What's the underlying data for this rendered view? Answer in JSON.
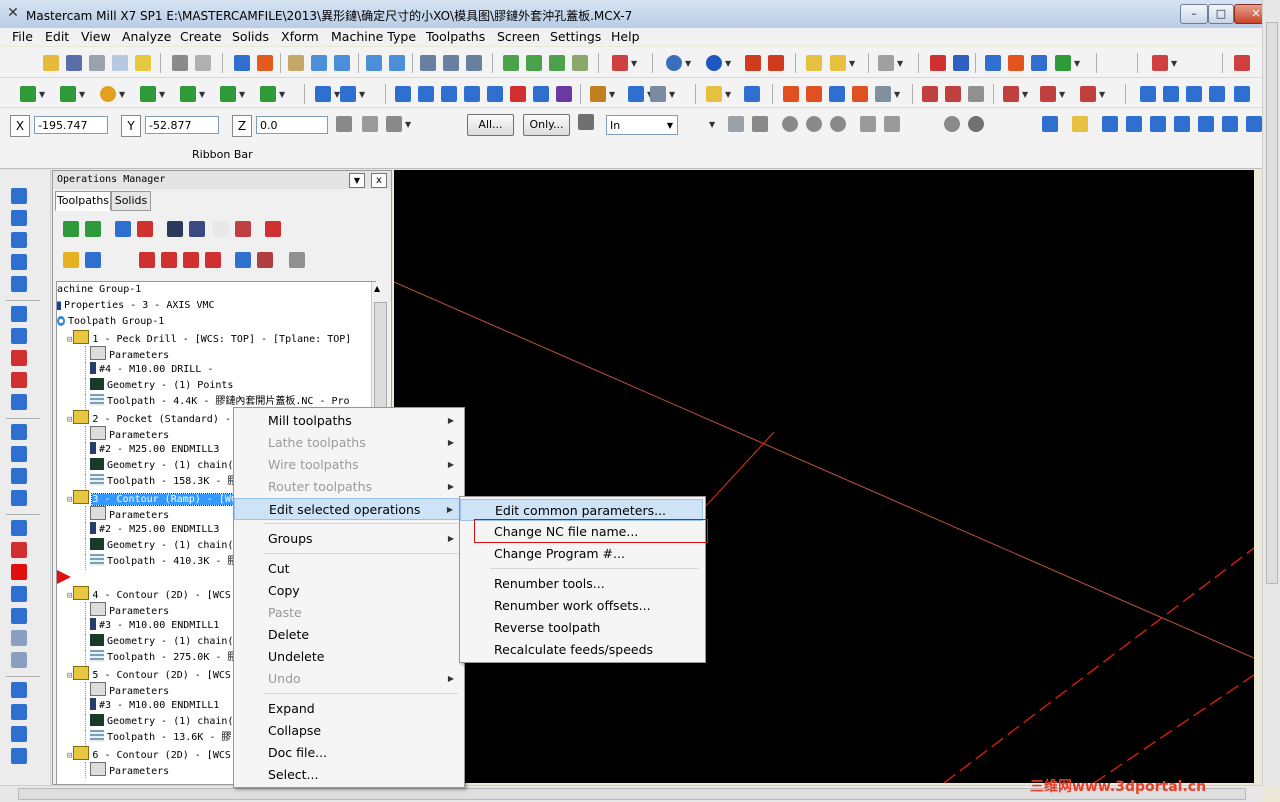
{
  "window": {
    "title": "Mastercam Mill X7 SP1  E:\\MASTERCAMFILE\\2013\\異形鏈\\确定尺寸的小XO\\模具图\\膠鏈外套沖孔蓋板.MCX-7",
    "controls": {
      "minimize": "–",
      "maximize": "□",
      "close": "✕"
    }
  },
  "menubar": [
    "File",
    "Edit",
    "View",
    "Analyze",
    "Create",
    "Solids",
    "Xform",
    "Machine Type",
    "Toolpaths",
    "Screen",
    "Settings",
    "Help"
  ],
  "ribbon": {
    "x_label": "X",
    "x_value": "-195.747",
    "y_label": "Y",
    "y_value": "-52.877",
    "z_label": "Z",
    "z_value": "0.0",
    "all_button": "All...",
    "only_button": "Only...",
    "unit_select": "In",
    "ribbon_bar_label": "Ribbon Bar"
  },
  "ops_manager": {
    "header": "Operations Manager",
    "tabs": [
      "Toolpaths",
      "Solids"
    ],
    "tree": [
      {
        "text": "achine Group-1",
        "indent": 0,
        "icon": "none"
      },
      {
        "text": "Properties - 3 - AXIS VMC",
        "indent": 0,
        "icon": "properties-icon"
      },
      {
        "text": "Toolpath Group-1",
        "indent": 0,
        "icon": "group-icon"
      },
      {
        "text": "1 - Peck Drill - [WCS: TOP] - [Tplane: TOP]",
        "indent": 1,
        "icon": "folder-icon"
      },
      {
        "text": "Parameters",
        "indent": 2,
        "icon": "params-icon"
      },
      {
        "text": "#4 - M10.00 DRILL -",
        "indent": 2,
        "icon": "tool-icon"
      },
      {
        "text": "Geometry - (1) Points",
        "indent": 2,
        "icon": "geometry-icon"
      },
      {
        "text": "Toolpath - 4.4K - 膠鏈內套開片蓋板.NC - Pro",
        "indent": 2,
        "icon": "toolpath-icon"
      },
      {
        "text": "2 - Pocket (Standard) - [",
        "indent": 1,
        "icon": "folder-icon"
      },
      {
        "text": "Parameters",
        "indent": 2,
        "icon": "params-icon"
      },
      {
        "text": "#2 - M25.00 ENDMILL3",
        "indent": 2,
        "icon": "tool-icon"
      },
      {
        "text": "Geometry - (1) chain(",
        "indent": 2,
        "icon": "geometry-icon"
      },
      {
        "text": "Toolpath - 158.3K - 膠",
        "indent": 2,
        "icon": "toolpath-icon"
      },
      {
        "text": "3 - Contour (Ramp) - [WC",
        "indent": 1,
        "icon": "folder-icon",
        "selected": true
      },
      {
        "text": "Parameters",
        "indent": 2,
        "icon": "params-icon"
      },
      {
        "text": "#2 - M25.00 ENDMILL3",
        "indent": 2,
        "icon": "tool-icon"
      },
      {
        "text": "Geometry - (1) chain(",
        "indent": 2,
        "icon": "geometry-icon"
      },
      {
        "text": "Toolpath - 410.3K - 膠",
        "indent": 2,
        "icon": "toolpath-icon"
      },
      {
        "text": "",
        "indent": 0,
        "icon": "insert-arrow-icon"
      },
      {
        "text": "4 - Contour (2D) - [WCS:",
        "indent": 1,
        "icon": "folder-icon"
      },
      {
        "text": "Parameters",
        "indent": 2,
        "icon": "params-icon"
      },
      {
        "text": "#3 - M10.00 ENDMILL1",
        "indent": 2,
        "icon": "tool-icon"
      },
      {
        "text": "Geometry - (1) chain(",
        "indent": 2,
        "icon": "geometry-icon"
      },
      {
        "text": "Toolpath - 275.0K - 膠",
        "indent": 2,
        "icon": "toolpath-icon"
      },
      {
        "text": "5 - Contour (2D) - [WCS:",
        "indent": 1,
        "icon": "folder-icon"
      },
      {
        "text": "Parameters",
        "indent": 2,
        "icon": "params-icon"
      },
      {
        "text": "#3 - M10.00 ENDMILL1",
        "indent": 2,
        "icon": "tool-icon"
      },
      {
        "text": "Geometry - (1) chain(",
        "indent": 2,
        "icon": "geometry-icon"
      },
      {
        "text": "Toolpath - 13.6K - 膠",
        "indent": 2,
        "icon": "toolpath-icon"
      },
      {
        "text": "6 - Contour (2D) - [WCS:",
        "indent": 1,
        "icon": "folder-icon"
      },
      {
        "text": "Parameters",
        "indent": 2,
        "icon": "params-icon"
      }
    ]
  },
  "context_menu": [
    {
      "label": "Mill toolpaths",
      "enabled": true,
      "submenu": true
    },
    {
      "label": "Lathe toolpaths",
      "enabled": false,
      "submenu": true
    },
    {
      "label": "Wire toolpaths",
      "enabled": false,
      "submenu": true
    },
    {
      "label": "Router toolpaths",
      "enabled": false,
      "submenu": true
    },
    {
      "label": "Edit selected operations",
      "enabled": true,
      "submenu": true,
      "active": true
    },
    {
      "sep": true
    },
    {
      "label": "Groups",
      "enabled": true,
      "submenu": true
    },
    {
      "sep": true
    },
    {
      "label": "Cut",
      "enabled": true
    },
    {
      "label": "Copy",
      "enabled": true
    },
    {
      "label": "Paste",
      "enabled": false
    },
    {
      "label": "Delete",
      "enabled": true
    },
    {
      "label": "Undelete",
      "enabled": true
    },
    {
      "label": "Undo",
      "enabled": false,
      "submenu": true
    },
    {
      "sep": true
    },
    {
      "label": "Expand",
      "enabled": true
    },
    {
      "label": "Collapse",
      "enabled": true
    },
    {
      "label": "Doc file...",
      "enabled": true
    },
    {
      "label": "Select...",
      "enabled": true
    }
  ],
  "submenu": [
    {
      "label": "Edit common parameters...",
      "active": true
    },
    {
      "label": "Change NC file name...",
      "highlighted_box": true
    },
    {
      "label": "Change Program #..."
    },
    {
      "sep": true
    },
    {
      "label": "Renumber tools..."
    },
    {
      "label": "Renumber work offsets..."
    },
    {
      "label": "Reverse toolpath"
    },
    {
      "label": "Recalculate feeds/speeds"
    }
  ],
  "watermark": "三维网www.3dportal.cn",
  "colors": {
    "viewport_bg": "#000000",
    "annotation_red": "#e03020",
    "selection_blue": "#3399ff",
    "menu_highlight": "#cfe3f7"
  }
}
